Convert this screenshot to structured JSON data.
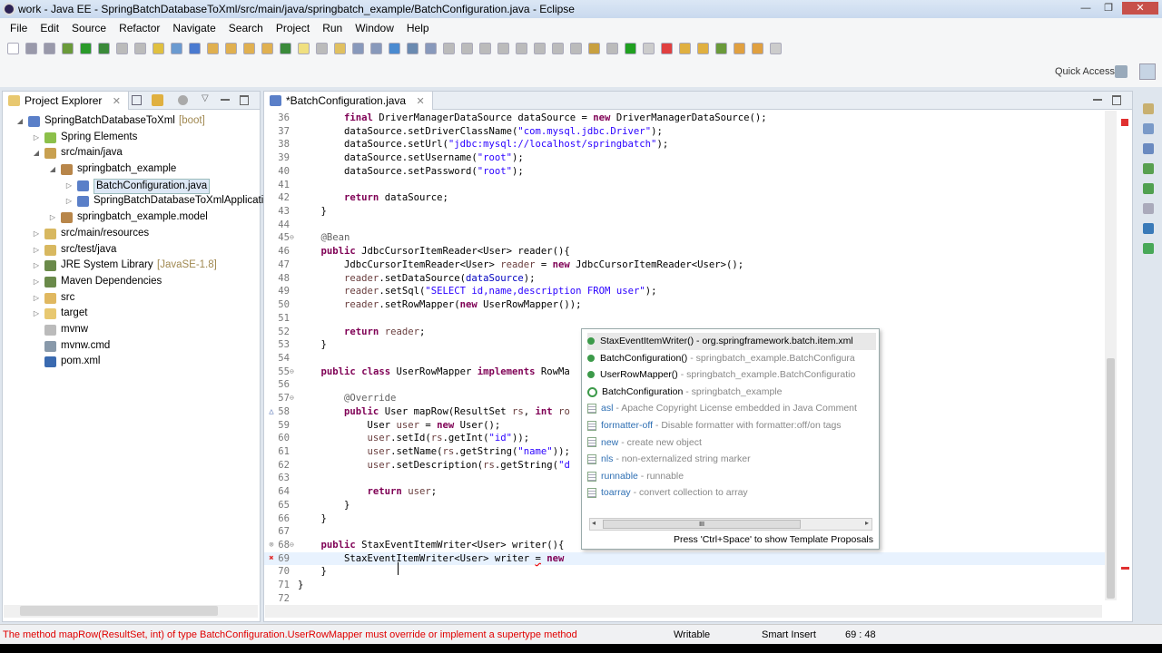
{
  "window": {
    "title": "work - Java EE - SpringBatchDatabaseToXml/src/main/java/springbatch_example/BatchConfiguration.java - Eclipse",
    "minimize": "—",
    "maximize": "❐",
    "close": "✕"
  },
  "menu": [
    "File",
    "Edit",
    "Source",
    "Refactor",
    "Navigate",
    "Search",
    "Project",
    "Run",
    "Window",
    "Help"
  ],
  "quick_access": "Quick Access",
  "project_explorer": {
    "title": "Project Explorer",
    "close": "✕",
    "items": [
      {
        "label": "SpringBatchDatabaseToXml",
        "deco": "[boot]",
        "level": 0,
        "tw": "◢",
        "icon": "#5a7fc8"
      },
      {
        "label": "Spring Elements",
        "level": 1,
        "tw": "▷",
        "icon": "#8cc04a"
      },
      {
        "label": "src/main/java",
        "level": 1,
        "tw": "◢",
        "icon": "#c8a050"
      },
      {
        "label": "springbatch_example",
        "level": 2,
        "tw": "◢",
        "icon": "#b8864a"
      },
      {
        "label": "BatchConfiguration.java",
        "level": 3,
        "tw": "▷",
        "icon": "#5a7fc8",
        "selected": true
      },
      {
        "label": "SpringBatchDatabaseToXmlApplicati",
        "level": 3,
        "tw": "▷",
        "icon": "#5a7fc8"
      },
      {
        "label": "springbatch_example.model",
        "level": 2,
        "tw": "▷",
        "icon": "#b8864a"
      },
      {
        "label": "src/main/resources",
        "level": 1,
        "tw": "▷",
        "icon": "#d8b860"
      },
      {
        "label": "src/test/java",
        "level": 1,
        "tw": "▷",
        "icon": "#d8b860"
      },
      {
        "label": "JRE System Library",
        "deco": "[JavaSE-1.8]",
        "level": 1,
        "tw": "▷",
        "icon": "#6a8a4a"
      },
      {
        "label": "Maven Dependencies",
        "level": 1,
        "tw": "▷",
        "icon": "#6a8a4a"
      },
      {
        "label": "src",
        "level": 1,
        "tw": "▷",
        "icon": "#e0b860"
      },
      {
        "label": "target",
        "level": 1,
        "tw": "▷",
        "icon": "#e8c870"
      },
      {
        "label": "mvnw",
        "level": 1,
        "tw": "",
        "icon": "#bbbbbb"
      },
      {
        "label": "mvnw.cmd",
        "level": 1,
        "tw": "",
        "icon": "#8899aa"
      },
      {
        "label": "pom.xml",
        "level": 1,
        "tw": "",
        "icon": "#3a6ab0"
      }
    ]
  },
  "editor": {
    "tab": "*BatchConfiguration.java",
    "close": "✕",
    "lines": [
      {
        "n": 36,
        "t": [
          [
            "        "
          ],
          [
            "final",
            "k"
          ],
          [
            " DriverManagerDataSource dataSource = "
          ],
          [
            "new",
            "k"
          ],
          [
            " DriverManagerDataSource();"
          ]
        ]
      },
      {
        "n": 37,
        "t": [
          [
            "        dataSource.setDriverClassName("
          ],
          [
            "\"com.mysql.jdbc.Driver\"",
            "s"
          ],
          [
            ");"
          ]
        ]
      },
      {
        "n": 38,
        "t": [
          [
            "        dataSource.setUrl("
          ],
          [
            "\"jdbc:mysql://localhost/springbatch\"",
            "s"
          ],
          [
            ");"
          ]
        ]
      },
      {
        "n": 39,
        "t": [
          [
            "        dataSource.setUsername("
          ],
          [
            "\"root\"",
            "s"
          ],
          [
            ");"
          ]
        ]
      },
      {
        "n": 40,
        "t": [
          [
            "        dataSource.setPassword("
          ],
          [
            "\"root\"",
            "s"
          ],
          [
            ");"
          ]
        ]
      },
      {
        "n": 41,
        "t": []
      },
      {
        "n": 42,
        "t": [
          [
            "        "
          ],
          [
            "return",
            "k"
          ],
          [
            " dataSource;"
          ]
        ]
      },
      {
        "n": 43,
        "t": [
          [
            "    }"
          ]
        ]
      },
      {
        "n": 44,
        "t": []
      },
      {
        "n": 45,
        "fold": "⊖",
        "t": [
          [
            "    "
          ],
          [
            "@Bean",
            "a"
          ]
        ]
      },
      {
        "n": 46,
        "t": [
          [
            "    "
          ],
          [
            "public",
            "k"
          ],
          [
            " JdbcCursorItemReader<User> reader(){"
          ]
        ]
      },
      {
        "n": 47,
        "t": [
          [
            "        JdbcCursorItemReader<User> "
          ],
          [
            "reader",
            "v"
          ],
          [
            " = "
          ],
          [
            "new",
            "k"
          ],
          [
            " JdbcCursorItemReader<User>();"
          ]
        ]
      },
      {
        "n": 48,
        "t": [
          [
            "        "
          ],
          [
            "reader",
            "v"
          ],
          [
            ".setDataSource("
          ],
          [
            "dataSource",
            "f"
          ],
          [
            ");"
          ]
        ]
      },
      {
        "n": 49,
        "t": [
          [
            "        "
          ],
          [
            "reader",
            "v"
          ],
          [
            ".setSql("
          ],
          [
            "\"SELECT id,name,description FROM user\"",
            "s"
          ],
          [
            ");"
          ]
        ]
      },
      {
        "n": 50,
        "t": [
          [
            "        "
          ],
          [
            "reader",
            "v"
          ],
          [
            ".setRowMapper("
          ],
          [
            "new",
            "k"
          ],
          [
            " UserRowMapper());"
          ]
        ]
      },
      {
        "n": 51,
        "t": []
      },
      {
        "n": 52,
        "t": [
          [
            "        "
          ],
          [
            "return",
            "k"
          ],
          [
            " "
          ],
          [
            "reader",
            "v"
          ],
          [
            ";"
          ]
        ]
      },
      {
        "n": 53,
        "t": [
          [
            "    }"
          ]
        ]
      },
      {
        "n": 54,
        "t": []
      },
      {
        "n": 55,
        "fold": "⊖",
        "t": [
          [
            "    "
          ],
          [
            "public",
            "k"
          ],
          [
            " "
          ],
          [
            "class",
            "k"
          ],
          [
            " UserRowMapper "
          ],
          [
            "implements",
            "k"
          ],
          [
            " RowMa"
          ]
        ]
      },
      {
        "n": 56,
        "t": []
      },
      {
        "n": 57,
        "fold": "⊖",
        "t": [
          [
            "        "
          ],
          [
            "@Override",
            "a"
          ]
        ]
      },
      {
        "n": 58,
        "marker": "△",
        "markerColor": "#4a6ab0",
        "t": [
          [
            "        "
          ],
          [
            "public",
            "k"
          ],
          [
            " User mapRow(ResultSet "
          ],
          [
            "rs",
            "v"
          ],
          [
            ", "
          ],
          [
            "int",
            "k"
          ],
          [
            " "
          ],
          [
            "ro",
            "v"
          ]
        ]
      },
      {
        "n": 59,
        "t": [
          [
            "            User "
          ],
          [
            "user",
            "v"
          ],
          [
            " = "
          ],
          [
            "new",
            "k"
          ],
          [
            " User();"
          ]
        ]
      },
      {
        "n": 60,
        "t": [
          [
            "            "
          ],
          [
            "user",
            "v"
          ],
          [
            ".setId("
          ],
          [
            "rs",
            "v"
          ],
          [
            ".getInt("
          ],
          [
            "\"id\"",
            "s"
          ],
          [
            "));"
          ]
        ]
      },
      {
        "n": 61,
        "t": [
          [
            "            "
          ],
          [
            "user",
            "v"
          ],
          [
            ".setName("
          ],
          [
            "rs",
            "v"
          ],
          [
            ".getString("
          ],
          [
            "\"name\"",
            "s"
          ],
          [
            "));"
          ]
        ]
      },
      {
        "n": 62,
        "t": [
          [
            "            "
          ],
          [
            "user",
            "v"
          ],
          [
            ".setDescription("
          ],
          [
            "rs",
            "v"
          ],
          [
            ".getString("
          ],
          [
            "\"d",
            "s"
          ]
        ]
      },
      {
        "n": 63,
        "t": []
      },
      {
        "n": 64,
        "t": [
          [
            "            "
          ],
          [
            "return",
            "k"
          ],
          [
            " "
          ],
          [
            "user",
            "v"
          ],
          [
            ";"
          ]
        ]
      },
      {
        "n": 65,
        "t": [
          [
            "        }"
          ]
        ]
      },
      {
        "n": 66,
        "t": [
          [
            "    }"
          ]
        ]
      },
      {
        "n": 67,
        "t": []
      },
      {
        "n": 68,
        "fold": "⊖",
        "marker": "⊗",
        "markerColor": "#999999",
        "t": [
          [
            "    "
          ],
          [
            "public",
            "k"
          ],
          [
            " StaxEventItemWriter<User> writer(){"
          ]
        ]
      },
      {
        "n": 69,
        "current": true,
        "marker": "✖",
        "markerColor": "#e03030",
        "t": [
          [
            "        StaxEventItemWriter<User> writer "
          ],
          [
            "=",
            "err"
          ],
          [
            " "
          ],
          [
            "new",
            "k"
          ]
        ]
      },
      {
        "n": 70,
        "t": [
          [
            "    }"
          ]
        ]
      },
      {
        "n": 71,
        "t": [
          [
            "}"
          ]
        ]
      },
      {
        "n": 72,
        "t": []
      }
    ]
  },
  "autocomplete": {
    "items": [
      {
        "kind": "method",
        "name": "StaxEventItemWriter()",
        "detail": "- org.springframework.batch.item.xml",
        "selected": true
      },
      {
        "kind": "method",
        "name": "BatchConfiguration()",
        "detail": "- springbatch_example.BatchConfigura"
      },
      {
        "kind": "method",
        "name": "UserRowMapper()",
        "detail": "- springbatch_example.BatchConfiguratio"
      },
      {
        "kind": "class",
        "name": "BatchConfiguration",
        "detail": "- springbatch_example"
      },
      {
        "kind": "template",
        "name": "asl",
        "detail": "- Apache Copyright License embedded in Java Comment"
      },
      {
        "kind": "template",
        "name": "formatter-off",
        "detail": "- Disable formatter with formatter:off/on tags"
      },
      {
        "kind": "template",
        "name": "new",
        "detail": "- create new object"
      },
      {
        "kind": "template",
        "name": "nls",
        "detail": "- non-externalized string marker"
      },
      {
        "kind": "template",
        "name": "runnable",
        "detail": "- runnable"
      },
      {
        "kind": "template",
        "name": "toarray",
        "detail": "- convert collection to array"
      }
    ],
    "scroll_grip": "III",
    "footer": "Press 'Ctrl+Space' to show Template Proposals"
  },
  "status": {
    "message": "The method mapRow(ResultSet, int) of type BatchConfiguration.UserRowMapper must override or implement a supertype method",
    "mode": "Writable",
    "insert": "Smart Insert",
    "position": "69 : 48"
  },
  "colors": {
    "error": "#e00000",
    "keyword": "#7f0055",
    "string": "#2a00ff"
  }
}
